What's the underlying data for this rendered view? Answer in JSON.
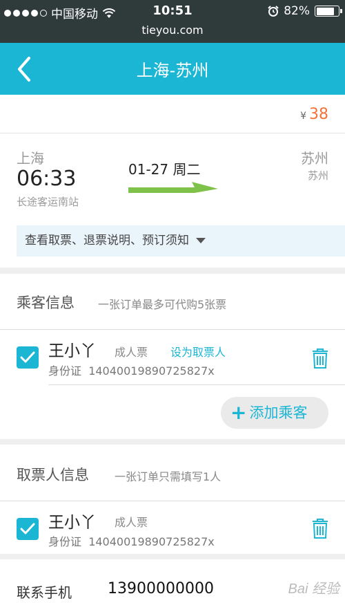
{
  "status_bar": {
    "carrier": "中国移动",
    "time": "10:51",
    "battery": "82%",
    "battery_level": 0.82,
    "signal_icon": "signal-dots-icon",
    "wifi_icon": "wifi-icon",
    "alarm_icon": "alarm-icon"
  },
  "browser": {
    "url": "tieyou.com"
  },
  "nav": {
    "title": "上海-苏州",
    "back_icon": "chevron-left-icon",
    "bg_color": "#1ab6d4"
  },
  "trip": {
    "currency": "¥",
    "price": "38",
    "from_city": "上海",
    "departure_time": "06:33",
    "from_station": "长途客运南站",
    "date": "01-27 周二",
    "to_city": "苏州",
    "to_station": "苏州",
    "notice": "查看取票、退票说明、预订须知"
  },
  "passengers": {
    "title": "乘客信息",
    "hint": "一张订单最多可代购5张票",
    "items": [
      {
        "name": "王小丫",
        "ticket_type": "成人票",
        "set_collector": "设为取票人",
        "id_type": "身份证",
        "id_number": "14040019890725827x",
        "checked": true
      }
    ],
    "add_label": "添加乘客"
  },
  "collector": {
    "title": "取票人信息",
    "hint": "一张订单只需填写1人",
    "name": "王小丫",
    "ticket_type": "成人票",
    "id_type": "身份证",
    "id_number": "14040019890725827x",
    "checked": true
  },
  "contact": {
    "label": "联系手机",
    "phone": "13900000000"
  },
  "watermark": "Bai 经验",
  "colors": {
    "accent": "#1ab6d4",
    "price": "#f2733a",
    "arrow": "#7ec24a"
  }
}
